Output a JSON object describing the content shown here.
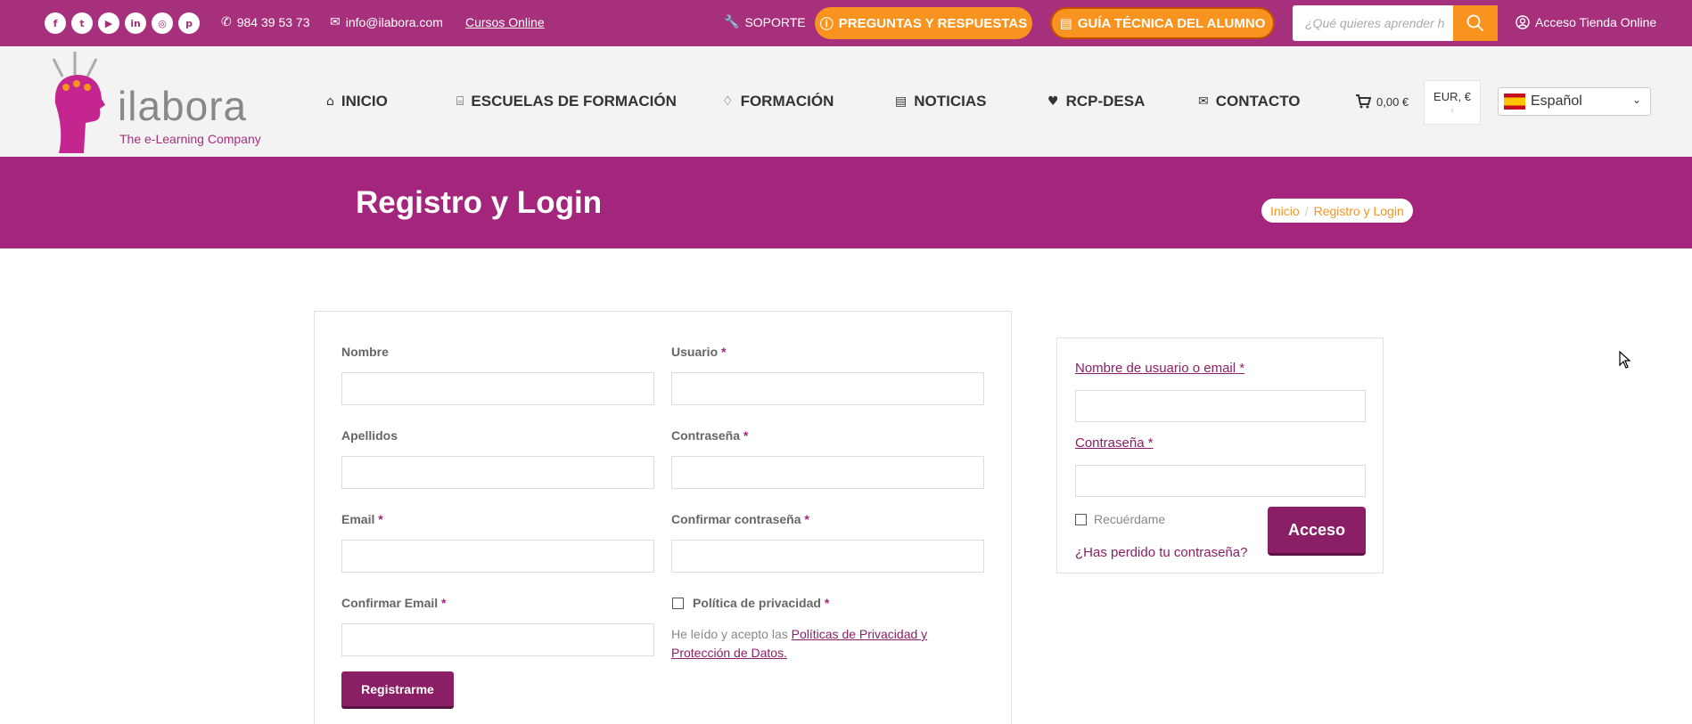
{
  "topbar": {
    "social": [
      "f",
      "t",
      "▶",
      "in",
      "◎",
      "p"
    ],
    "social_names": [
      "facebook-icon",
      "twitter-icon",
      "youtube-icon",
      "linkedin-icon",
      "instagram-icon",
      "pinterest-icon"
    ],
    "phone": "984 39 53 73",
    "email": "info@ilabora.com",
    "courses_link": "Cursos Online",
    "support": "SOPORTE",
    "faq_button": "PREGUNTAS Y RESPUESTAS",
    "guide_button": "GUÍA TÉCNICA DEL ALUMNO",
    "search_placeholder": "¿Qué quieres aprender h",
    "store_access": "Acceso Tienda Online"
  },
  "logo": {
    "wordmark": "ilabora",
    "tagline": "The e-Learning Company"
  },
  "nav": {
    "items": [
      {
        "label": "INICIO",
        "icon": "home-icon"
      },
      {
        "label": "ESCUELAS DE FORMACIÓN",
        "icon": "bank-icon"
      },
      {
        "label": "FORMACIÓN",
        "icon": "graduation-cap-icon"
      },
      {
        "label": "NOTICIAS",
        "icon": "newspaper-icon"
      },
      {
        "label": "RCP-DESA",
        "icon": "heartbeat-icon"
      },
      {
        "label": "CONTACTO",
        "icon": "envelope-icon"
      }
    ],
    "cart_total": "0,00 €",
    "currency": "EUR, €",
    "language": "Español"
  },
  "title_band": {
    "title": "Registro y Login",
    "breadcrumb": [
      "Inicio",
      "Registro y Login"
    ]
  },
  "register": {
    "labels": {
      "first_name": "Nombre",
      "username": "Usuario",
      "last_name": "Apellidos",
      "password": "Contraseña",
      "email": "Email",
      "confirm_password": "Confirmar contraseña",
      "confirm_email": "Confirmar Email",
      "privacy": "Política de privacidad"
    },
    "required_mark": "*",
    "privacy_text_prefix": "He leído y acepto las ",
    "privacy_link": "Políticas de Privacidad y Protección de Datos.",
    "submit": "Registrarme"
  },
  "login": {
    "username_label": "Nombre de usuario o email",
    "password_label": "Contraseña",
    "required_mark": "*",
    "remember": "Recuérdame",
    "submit": "Acceso",
    "lost_password": "¿Has perdido tu contraseña?"
  },
  "colors": {
    "brand_purple": "#a3267c",
    "brand_orange": "#f7931e",
    "button_purple": "#8a1f66"
  }
}
